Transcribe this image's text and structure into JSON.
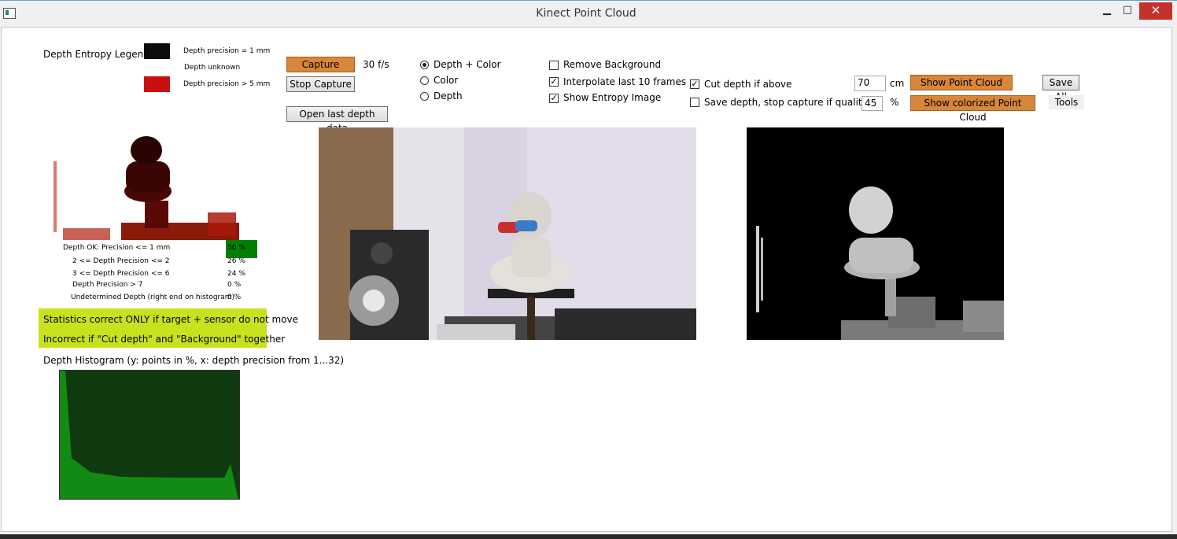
{
  "window": {
    "title": "Kinect Point Cloud",
    "close_glyph": "✕",
    "min_glyph": "▁",
    "max_glyph": "□"
  },
  "legend": {
    "title": "Depth Entropy Legend",
    "precision1": "Depth precision = 1 mm",
    "unknown": "Depth  unknown",
    "precision5": "Depth precision > 5 mm",
    "swatch_black": "#0c0c0c",
    "swatch_red": "#c81010"
  },
  "capture": {
    "capture_label": "Capture",
    "fps": "30 f/s",
    "stop_label": "Stop Capture",
    "open_label": "Open last depth data"
  },
  "mode": {
    "options": [
      "Depth + Color",
      "Color",
      "Depth"
    ],
    "selected": "Depth + Color"
  },
  "options": {
    "remove_background": "Remove Background",
    "interpolate": "Interpolate last 10 frames",
    "show_entropy": "Show Entropy Image",
    "cut_depth": "Cut depth if above",
    "cut_depth_value": "70",
    "cut_depth_unit": "cm",
    "save_depth": "Save depth, stop capture if quality >",
    "quality_value": "45",
    "quality_unit": "%",
    "remove_background_checked": false,
    "interpolate_checked": true,
    "show_entropy_checked": true,
    "cut_depth_checked": true,
    "save_depth_checked": false
  },
  "actions": {
    "show_point_cloud": "Show Point Cloud",
    "show_colorized": "Show colorized Point Cloud",
    "save_all": "Save All",
    "tools": "Tools"
  },
  "stats": {
    "rows": [
      {
        "label": "Depth OK: Precision <= 1 mm",
        "value": "50 %"
      },
      {
        "label": "2 <= Depth Precision <= 2",
        "value": "26 %"
      },
      {
        "label": "3 <= Depth Precision <= 6",
        "value": "24 %"
      },
      {
        "label": "Depth Precision > 7",
        "value": "0 %"
      },
      {
        "label": "Undetermined Depth (right end on histogram)",
        "value": "0 %"
      }
    ],
    "ok_fraction": 0.5,
    "ok_color": "#008000"
  },
  "warning": {
    "line1": "Statistics correct ONLY if target + sensor do not move",
    "line2": "Incorrect if \"Cut depth\" and \"Background\" together",
    "color": "#c9e21e"
  },
  "histogram": {
    "title": "Depth Histogram (y: points in %, x: depth precision from 1...32)",
    "bg_color": "#0f3a0f",
    "fill_color": "#138a13"
  }
}
